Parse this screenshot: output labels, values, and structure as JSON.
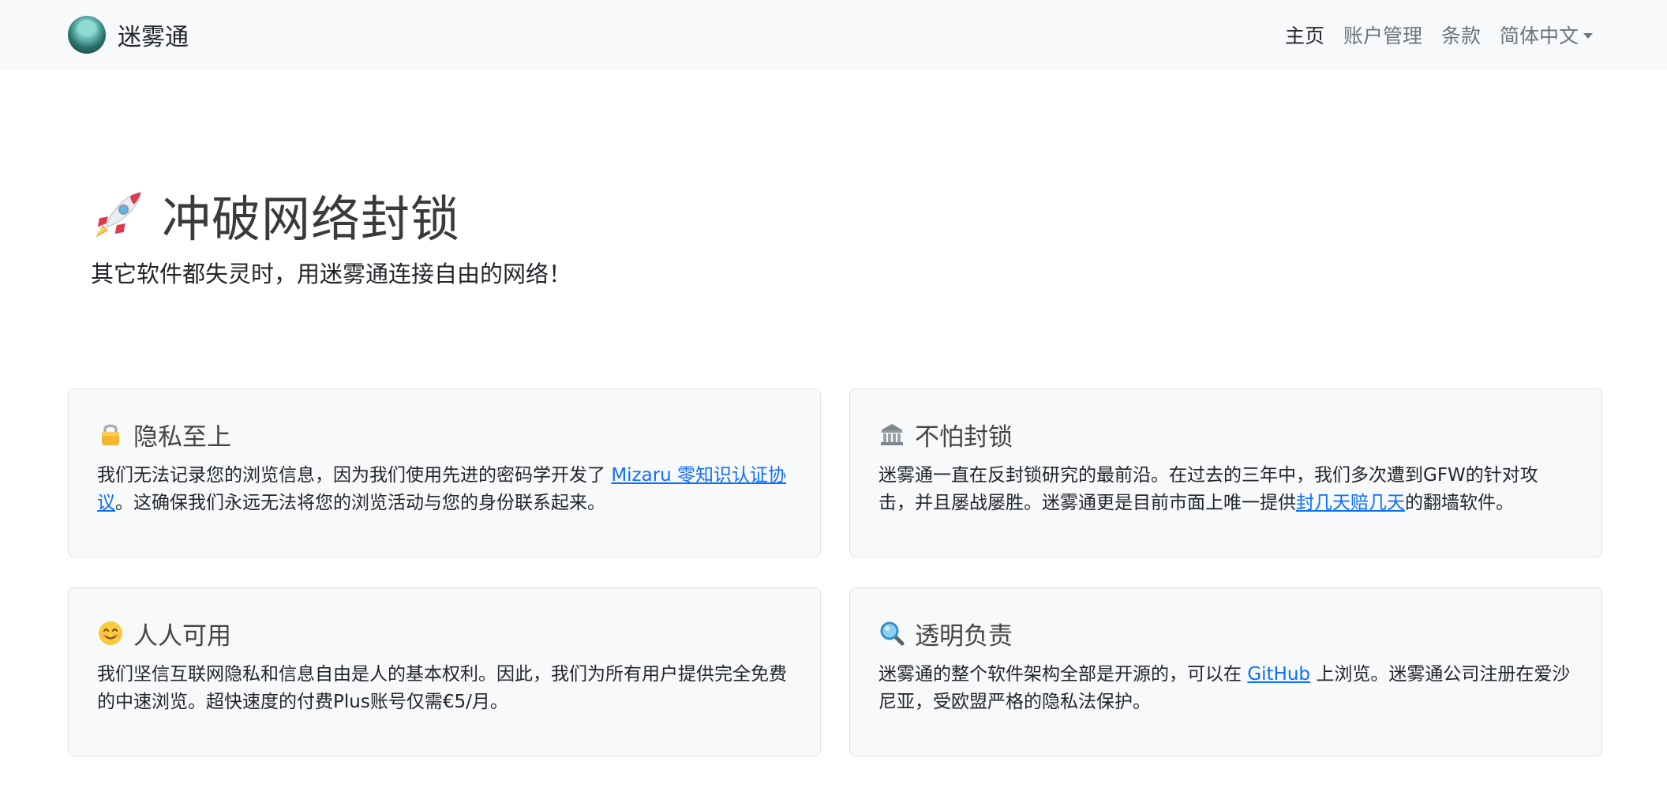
{
  "navbar": {
    "brand_name": "迷雾通",
    "links": {
      "home": "主页",
      "account": "账户管理",
      "terms": "条款",
      "language": "简体中文"
    }
  },
  "hero": {
    "title": "冲破网络封锁",
    "subtitle": "其它软件都失灵时，用迷雾通连接自由的网络！"
  },
  "cards": {
    "privacy": {
      "icon": "lock-icon",
      "title": "隐私至上",
      "text_before": "我们无法记录您的浏览信息，因为我们使用先进的密码学开发了 ",
      "link": "Mizaru 零知识认证协议",
      "text_after": "。这确保我们永远无法将您的浏览活动与您的身份联系起来。"
    },
    "censorship": {
      "icon": "bank-icon",
      "title": "不怕封锁",
      "text_before": "迷雾通一直在反封锁研究的最前沿。在过去的三年中，我们多次遭到GFW的针对攻击，并且屡战屡胜。迷雾通更是目前市面上唯一提供",
      "link": "封几天赔几天",
      "text_after": "的翻墙软件。"
    },
    "accessible": {
      "icon": "smile-icon",
      "title": "人人可用",
      "text": "我们坚信互联网隐私和信息自由是人的基本权利。因此，我们为所有用户提供完全免费的中速浏览。超快速度的付费Plus账号仅需€5/月。"
    },
    "transparent": {
      "icon": "magnifier-icon",
      "title": "透明负责",
      "text_before": "迷雾通的整个软件架构全部是开源的，可以在 ",
      "link": "GitHub",
      "text_after": " 上浏览。迷雾通公司注册在爱沙尼亚，受欧盟严格的隐私法保护。"
    }
  },
  "colors": {
    "link": "#0d6efd",
    "navbar_bg": "#f8f9fa",
    "card_bg": "#f8f9fa"
  }
}
